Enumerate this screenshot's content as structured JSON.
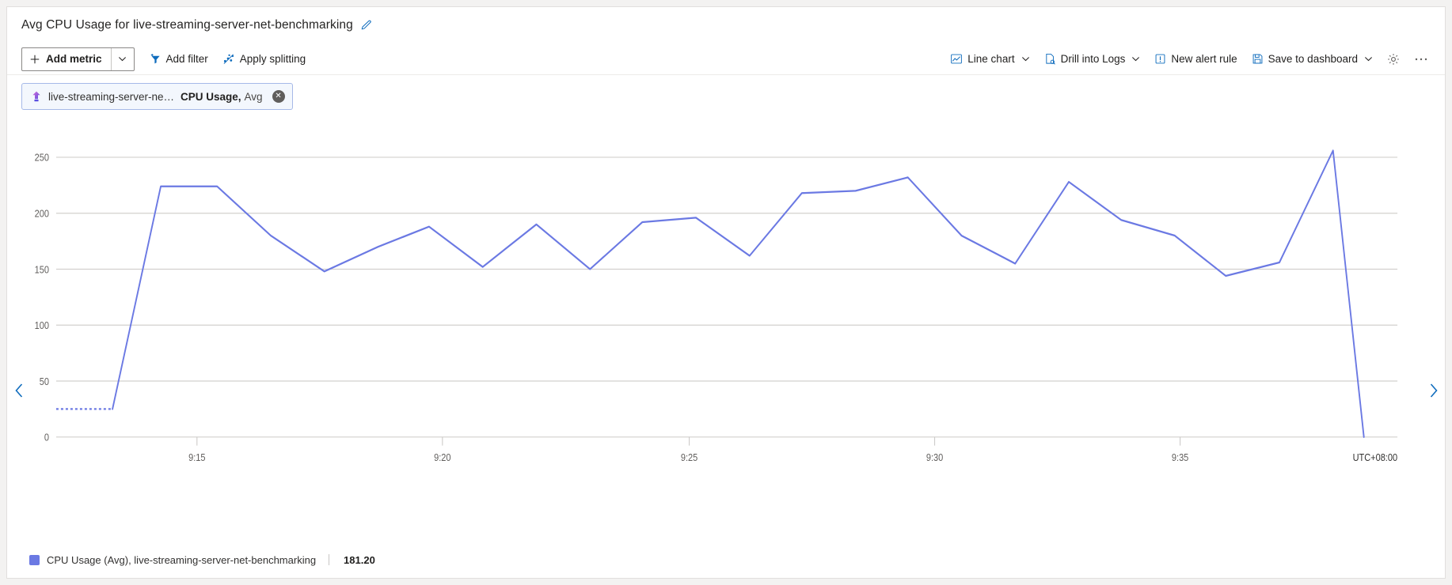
{
  "header": {
    "title": "Avg CPU Usage for live-streaming-server-net-benchmarking",
    "edit_icon": "pencil-icon"
  },
  "toolbar": {
    "add_metric_label": "Add metric",
    "add_metric_icon": "plus-icon",
    "add_metric_caret_icon": "chevron-down-icon",
    "add_filter_label": "Add filter",
    "add_filter_icon": "filter-plus-icon",
    "apply_splitting_label": "Apply splitting",
    "apply_splitting_icon": "splitting-icon",
    "line_chart_label": "Line chart",
    "line_chart_icon": "line-chart-icon",
    "line_chart_caret_icon": "chevron-down-icon",
    "drill_logs_label": "Drill into Logs",
    "drill_logs_icon": "logs-document-icon",
    "drill_logs_caret_icon": "chevron-down-icon",
    "new_alert_label": "New alert rule",
    "new_alert_icon": "alert-bell-icon",
    "save_dashboard_label": "Save to dashboard",
    "save_dashboard_icon": "save-disk-icon",
    "save_dashboard_caret_icon": "chevron-down-icon",
    "settings_icon": "gear-icon",
    "more_icon": "ellipsis-icon"
  },
  "metric_chip": {
    "resource_icon": "azure-resource-icon",
    "resource": "live-streaming-server-net-...",
    "metric": "CPU Usage,",
    "aggregation": "Avg",
    "close_icon": "close-icon"
  },
  "navigation": {
    "prev_icon": "chevron-left-icon",
    "next_icon": "chevron-right-icon"
  },
  "legend": {
    "swatch_color": "#6b79e3",
    "label": "CPU Usage (Avg), live-streaming-server-net-benchmarking",
    "value": "181.20"
  },
  "chart_data": {
    "type": "line",
    "title": "Avg CPU Usage for live-streaming-server-net-benchmarking",
    "xlabel": "",
    "ylabel": "",
    "timezone": "UTC+08:00",
    "grid": true,
    "legend_position": "bottom-left",
    "line_color": "#6b79e3",
    "ylim": [
      0,
      270
    ],
    "yticks": [
      0,
      50,
      100,
      150,
      200,
      250
    ],
    "ytick_labels": [
      "0",
      "50",
      "100",
      "150",
      "200",
      "250"
    ],
    "xticks": [
      "9:15",
      "9:20",
      "9:25",
      "9:30",
      "9:35"
    ],
    "xtick_positions": [
      0.105,
      0.288,
      0.472,
      0.655,
      0.838
    ],
    "series": [
      {
        "name": "CPU Usage (Avg), live-streaming-server-net-benchmarking",
        "current_value": 181.2,
        "leading_dashed_segment": true,
        "x": [
          0.0,
          0.042,
          0.078,
          0.12,
          0.16,
          0.2,
          0.24,
          0.278,
          0.318,
          0.358,
          0.398,
          0.437,
          0.477,
          0.517,
          0.556,
          0.596,
          0.635,
          0.675,
          0.715,
          0.755,
          0.794,
          0.834,
          0.872,
          0.912,
          0.952,
          0.975
        ],
        "values": [
          25,
          25,
          224,
          224,
          180,
          148,
          170,
          188,
          152,
          190,
          150,
          192,
          196,
          162,
          218,
          220,
          232,
          180,
          155,
          228,
          194,
          180,
          144,
          156,
          256,
          0
        ]
      }
    ]
  }
}
